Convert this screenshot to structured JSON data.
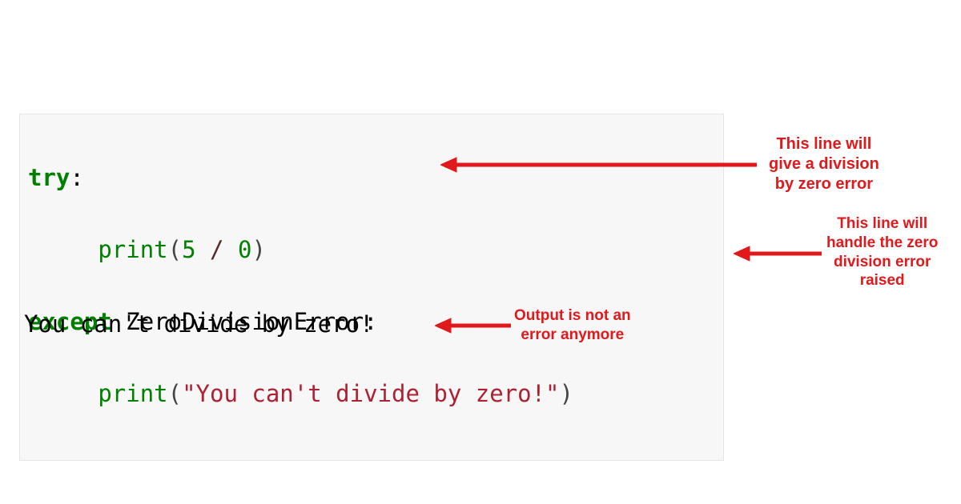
{
  "code": {
    "line1": {
      "kw": "try",
      "colon": ":"
    },
    "line2": {
      "indent": "     ",
      "func": "print",
      "open": "(",
      "num1": "5",
      "space1": " ",
      "op": "/",
      "space2": " ",
      "num2": "0",
      "close": ")"
    },
    "line3": {
      "kw": "except",
      "space": " ",
      "exc": "ZeroDivisionError",
      "colon": ":"
    },
    "line4": {
      "indent": "     ",
      "func": "print",
      "open": "(",
      "str": "\"You can't divide by zero!\"",
      "close": ")"
    }
  },
  "output": "You can't divide by zero!",
  "annotations": {
    "a1": {
      "l1": "This line will",
      "l2": "give a division",
      "l3": "by zero error"
    },
    "a2": {
      "l1": "This line will",
      "l2": "handle the zero",
      "l3": "division error",
      "l4": "raised"
    },
    "a3": {
      "l1": "Output is not an",
      "l2": "error anymore"
    }
  },
  "colors": {
    "annotation": "#e0191c",
    "code_bg": "#f7f7f7"
  }
}
